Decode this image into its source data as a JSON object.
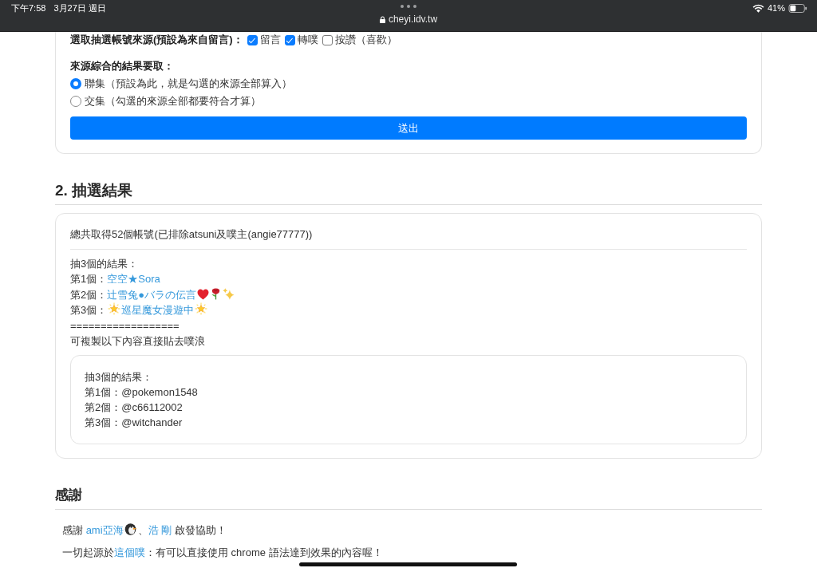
{
  "status_bar": {
    "time": "下午7:58",
    "date": "3月27日 週日",
    "url": "cheyi.idv.tw",
    "battery": "41%"
  },
  "source_form": {
    "sources_label": "選取抽選帳號來源(預設為來自留言)：",
    "sources": [
      {
        "label": "留言",
        "checked": true
      },
      {
        "label": "轉噗",
        "checked": true
      },
      {
        "label": "按讚（喜歡）",
        "checked": false
      }
    ],
    "combine_label": "來源綜合的結果要取：",
    "combine_options": [
      {
        "label": "聯集（預設為此，就是勾選的來源全部算入）",
        "selected": true
      },
      {
        "label": "交集（勾選的來源全部都要符合才算）",
        "selected": false
      }
    ],
    "submit_button": "送出"
  },
  "results": {
    "heading": "2. 抽選結果",
    "summary": "總共取得52個帳號(已排除atsuni及噗主(angie77777))",
    "draw_title": "抽3個的結果：",
    "winners": [
      {
        "label": "第1個：",
        "name": [
          {
            "kind": "text",
            "text": "空空★Sora"
          }
        ]
      },
      {
        "label": "第2個：",
        "name": [
          {
            "kind": "text",
            "text": "辻雪兔●バラの伝言"
          },
          {
            "kind": "heart"
          },
          {
            "kind": "rose"
          },
          {
            "kind": "sparkles"
          }
        ]
      },
      {
        "label": "第3個：",
        "name": [
          {
            "kind": "glowing-star"
          },
          {
            "kind": "text",
            "text": "巡星魔女漫遊中"
          },
          {
            "kind": "glowing-star"
          }
        ]
      }
    ],
    "separator": "==================",
    "copy_hint": "可複製以下內容直接貼去噗浪",
    "copy_lines": [
      "抽3個的結果：",
      "第1個：@pokemon1548",
      "第2個：@c66112002",
      "第3個：@witchander"
    ]
  },
  "thanks": {
    "heading": "感謝",
    "lines": [
      {
        "parts": [
          {
            "kind": "text",
            "text": "感謝 "
          },
          {
            "kind": "link",
            "text": "ami亞海"
          },
          {
            "kind": "penguin"
          },
          {
            "kind": "text",
            "text": "、"
          },
          {
            "kind": "link",
            "text": "浩 剛"
          },
          {
            "kind": "text",
            "text": " 啟發協助！"
          }
        ]
      },
      {
        "parts": [
          {
            "kind": "text",
            "text": "一切起源於"
          },
          {
            "kind": "link",
            "text": "這個噗"
          },
          {
            "kind": "text",
            "text": "：有可以直接使用 chrome 語法達到效果的內容喔！"
          }
        ]
      }
    ]
  }
}
